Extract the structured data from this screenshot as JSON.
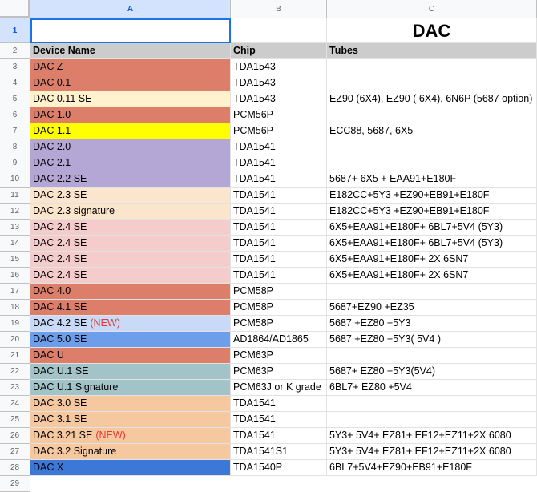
{
  "columns": [
    "A",
    "B",
    "C"
  ],
  "title": "DAC",
  "headers": {
    "device": "Device Name",
    "chip": "Chip",
    "tubes": "Tubes"
  },
  "rows": [
    {
      "num": "3",
      "device": "DAC Z",
      "chip": "TDA1543",
      "tubes": "",
      "color": "#dd7e6b"
    },
    {
      "num": "4",
      "device": "DAC 0.1",
      "chip": "TDA1543",
      "tubes": "",
      "color": "#dd7e6b"
    },
    {
      "num": "5",
      "device": "DAC 0.11 SE",
      "chip": "TDA1543",
      "tubes": "EZ90 (6X4), EZ90 ( 6X4), 6N6P (5687 option)",
      "color": "#fff2cc"
    },
    {
      "num": "6",
      "device": "DAC 1.0",
      "chip": "PCM56P",
      "tubes": "",
      "color": "#dd7e6b"
    },
    {
      "num": "7",
      "device": "DAC 1.1",
      "chip": "PCM56P",
      "tubes": "ECC88, 5687, 6X5",
      "color": "#ffff00"
    },
    {
      "num": "8",
      "device": "DAC 2.0",
      "chip": "TDA1541",
      "tubes": "",
      "color": "#b4a7d6"
    },
    {
      "num": "9",
      "device": "DAC 2.1",
      "chip": "TDA1541",
      "tubes": "",
      "color": "#b4a7d6"
    },
    {
      "num": "10",
      "device": "DAC 2.2 SE",
      "chip": "TDA1541",
      "tubes": "5687+ 6X5 + EAA91+E180F",
      "color": "#b4a7d6"
    },
    {
      "num": "11",
      "device": "DAC 2.3 SE",
      "chip": "TDA1541",
      "tubes": "E182CC+5Y3 +EZ90+EB91+E180F",
      "color": "#fce5cd"
    },
    {
      "num": "12",
      "device": "DAC 2.3 signature",
      "chip": "TDA1541",
      "tubes": "E182CC+5Y3 +EZ90+EB91+E180F",
      "color": "#fce5cd"
    },
    {
      "num": "13",
      "device": "DAC 2.4 SE",
      "chip": "TDA1541",
      "tubes": "6X5+EAA91+E180F+ 6BL7+5V4 (5Y3)",
      "color": "#f4cccc"
    },
    {
      "num": "14",
      "device": "DAC 2.4 SE",
      "chip": "TDA1541",
      "tubes": "6X5+EAA91+E180F+ 6BL7+5V4 (5Y3)",
      "color": "#f4cccc"
    },
    {
      "num": "15",
      "device": "DAC 2.4 SE",
      "chip": "TDA1541",
      "tubes": "6X5+EAA91+E180F+ 2X 6SN7",
      "color": "#f4cccc"
    },
    {
      "num": "16",
      "device": "DAC 2.4 SE",
      "chip": "TDA1541",
      "tubes": "6X5+EAA91+E180F+ 2X 6SN7",
      "color": "#f4cccc"
    },
    {
      "num": "17",
      "device": "DAC 4.0",
      "chip": "PCM58P",
      "tubes": "",
      "color": "#dd7e6b"
    },
    {
      "num": "18",
      "device": "DAC 4.1 SE",
      "chip": "PCM58P",
      "tubes": "5687+EZ90 +EZ35",
      "color": "#dd7e6b"
    },
    {
      "num": "19",
      "device": "DAC 4.2 SE",
      "new": "(NEW)",
      "chip": "PCM58P",
      "tubes": "5687 +EZ80 +5Y3",
      "color": "#c9daf8"
    },
    {
      "num": "20",
      "device": "DAC 5.0 SE",
      "chip": "AD1864/AD1865",
      "tubes": "5687 +EZ80 +5Y3( 5V4 )",
      "color": "#6d9eeb"
    },
    {
      "num": "21",
      "device": "DAC U",
      "chip": "PCM63P",
      "tubes": "",
      "color": "#dd7e6b"
    },
    {
      "num": "22",
      "device": "DAC U.1 SE",
      "chip": "PCM63P",
      "tubes": "5687+ EZ80 +5Y3(5V4)",
      "color": "#a2c4c9"
    },
    {
      "num": "23",
      "device": "DAC U.1 Signature",
      "chip": "PCM63J or K grade",
      "tubes": "6BL7+ EZ80 +5V4",
      "color": "#a2c4c9"
    },
    {
      "num": "24",
      "device": "DAC 3.0 SE",
      "chip": "TDA1541",
      "tubes": "",
      "color": "#f6c89f"
    },
    {
      "num": "25",
      "device": "DAC 3.1 SE",
      "chip": "TDA1541",
      "tubes": "",
      "color": "#f6c89f"
    },
    {
      "num": "26",
      "device": "DAC 3.21 SE",
      "new": "(NEW)",
      "chip": "TDA1541",
      "tubes": "5Y3+ 5V4+ EZ81+ EF12+EZ11+2X 6080",
      "color": "#f6c89f"
    },
    {
      "num": "27",
      "device": "DAC 3.2 Signature",
      "chip": "TDA1541S1",
      "tubes": "5Y3+ 5V4+ EZ81+ EF12+EZ11+2X 6080",
      "color": "#f6c89f"
    },
    {
      "num": "28",
      "device": "DAC X",
      "chip": "TDA1540P",
      "tubes": "6BL7+5V4+EZ90+EB91+E180F",
      "color": "#3c78d8"
    }
  ],
  "blank_row": "29"
}
